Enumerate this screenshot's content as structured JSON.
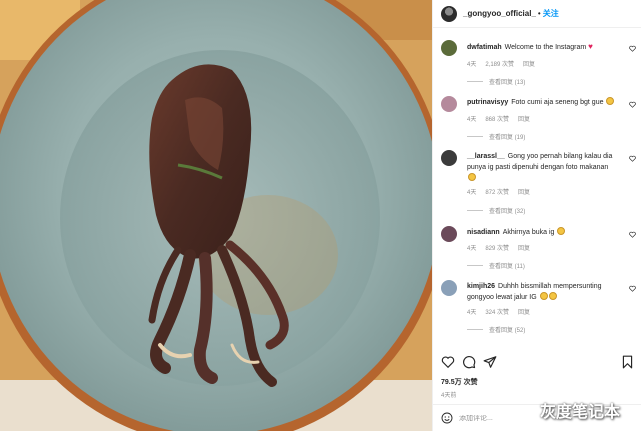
{
  "post": {
    "username": "_gongyoo_official_",
    "separator": "•",
    "follow_label": "关注"
  },
  "comments": [
    {
      "user": "dwfatimah",
      "text": "Welcome to the Instagram",
      "emoji": "heart",
      "time": "4天",
      "likes": "2,189 次赞",
      "reply": "回复",
      "view_replies": "查看回复 (13)",
      "avatar_color": "#5b6b3a"
    },
    {
      "user": "putrinavisyy",
      "text": "Foto cumi aja seneng bgt gue",
      "emoji": "smile",
      "time": "4天",
      "likes": "868 次赞",
      "reply": "回复",
      "view_replies": "查看回复 (19)",
      "avatar_color": "#b58a9c"
    },
    {
      "user": "__larassl__",
      "text": "Gong yoo pernah bilang kalau dia punya ig pasti dipenuhi dengan foto makanan",
      "emoji": "smile",
      "time": "4天",
      "likes": "872 次赞",
      "reply": "回复",
      "view_replies": "查看回复 (32)",
      "avatar_color": "#3b3b3b"
    },
    {
      "user": "nisadiann",
      "text": "Akhirnya buka ig",
      "emoji": "smile",
      "time": "4天",
      "likes": "829 次赞",
      "reply": "回复",
      "view_replies": "查看回复 (11)",
      "avatar_color": "#6b4a5a"
    },
    {
      "user": "kimjih26",
      "text": "Duhhh bissmillah mempersunting gongyoo lewat jalur IG",
      "emoji": "smile2",
      "time": "4天",
      "likes": "324 次赞",
      "reply": "回复",
      "view_replies": "查看回复 (52)",
      "avatar_color": "#8aa0b8"
    }
  ],
  "actions": {
    "like_icon": "heart-outline-icon",
    "comment_icon": "comment-bubble-icon",
    "share_icon": "paper-plane-icon",
    "save_icon": "bookmark-icon"
  },
  "likes": "79.5万 次赞",
  "time": "4天前",
  "comment_box": {
    "placeholder": "添加评论..."
  },
  "watermark": "灰度笔记本",
  "colors": {
    "follow": "#0095f6",
    "meta": "#8e8e8e",
    "plate": "#8fa9a7",
    "plate_rim": "#b5652e",
    "table": "#d6a25c"
  }
}
